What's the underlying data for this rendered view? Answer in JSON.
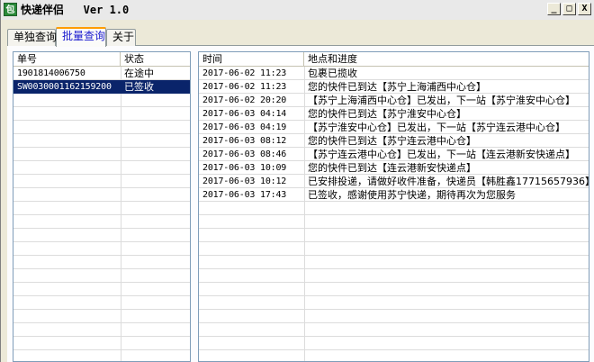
{
  "window": {
    "title": "快递伴侣   Ver 1.0",
    "icon_name": "package-icon",
    "buttons": [
      "_",
      "□",
      "X"
    ]
  },
  "tabs": [
    {
      "label": "单独查询",
      "active": false
    },
    {
      "label": "批量查询",
      "active": true
    },
    {
      "label": "关于",
      "active": false
    }
  ],
  "orders": {
    "columns": [
      "单号",
      "状态"
    ],
    "rows": [
      {
        "number": "1901814006750",
        "status": "在途中",
        "selected": false
      },
      {
        "number": "SW0030001162159200",
        "status": "已签收",
        "selected": true
      }
    ]
  },
  "tracking": {
    "columns": [
      "时间",
      "地点和进度"
    ],
    "rows": [
      {
        "time": "2017-06-02 11:23",
        "detail": "包裹已揽收"
      },
      {
        "time": "2017-06-02 11:23",
        "detail": "您的快件已到达【苏宁上海浦西中心仓】"
      },
      {
        "time": "2017-06-02 20:20",
        "detail": "【苏宁上海浦西中心仓】已发出，下一站【苏宁淮安中心仓】"
      },
      {
        "time": "2017-06-03 04:14",
        "detail": "您的快件已到达【苏宁淮安中心仓】"
      },
      {
        "time": "2017-06-03 04:19",
        "detail": "【苏宁淮安中心仓】已发出，下一站【苏宁连云港中心仓】"
      },
      {
        "time": "2017-06-03 08:12",
        "detail": "您的快件已到达【苏宁连云港中心仓】"
      },
      {
        "time": "2017-06-03 08:46",
        "detail": "【苏宁连云港中心仓】已发出，下一站【连云港新安快递点】"
      },
      {
        "time": "2017-06-03 10:09",
        "detail": "您的快件已到达【连云港新安快递点】"
      },
      {
        "time": "2017-06-03 10:12",
        "detail": "已安排投递，请做好收件准备，快递员【韩胜鑫17715657936】"
      },
      {
        "time": "2017-06-03 17:43",
        "detail": "已签收，感谢使用苏宁快递，期待再次为您服务"
      }
    ]
  },
  "colors": {
    "selection": "#0a246a",
    "active_tab_text": "#1b1bcf",
    "active_tab_accent": "#ff9c00"
  }
}
